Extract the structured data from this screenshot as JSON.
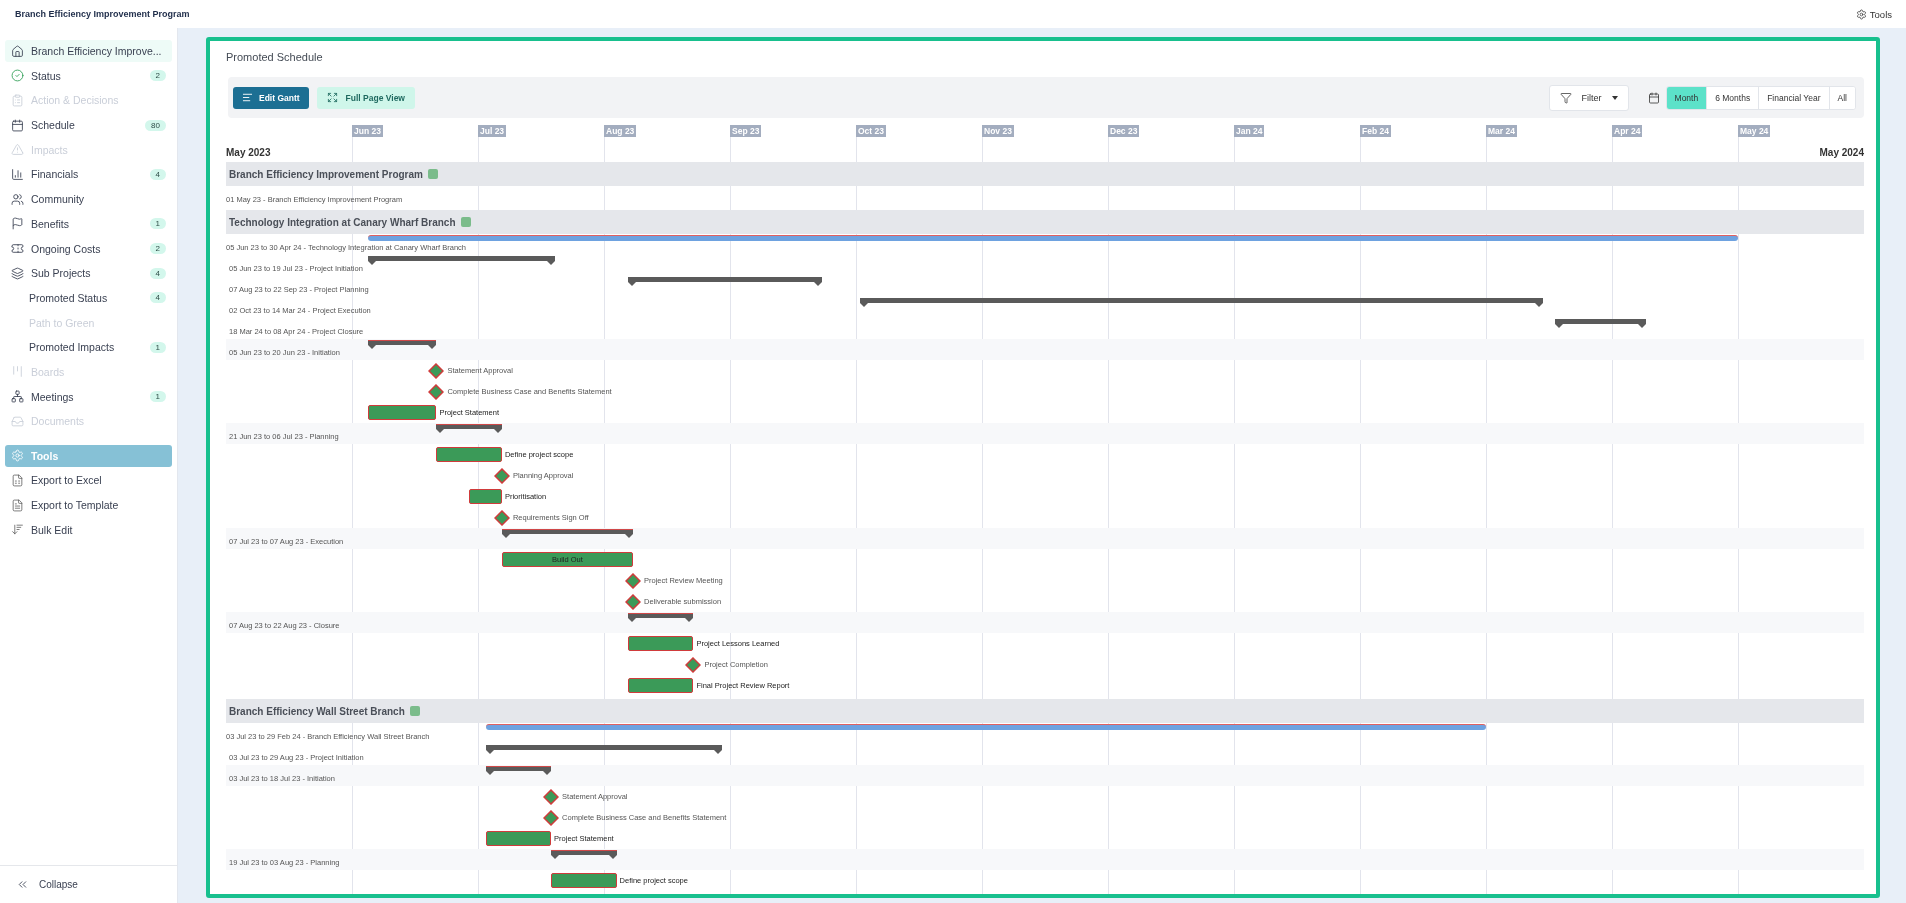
{
  "app_bar": {
    "title": "Branch Efficiency Improvement Program",
    "tools_label": "Tools"
  },
  "sidebar": {
    "items": [
      {
        "label": "Branch Efficiency Improve...",
        "selected": true,
        "disabled": false
      },
      {
        "label": "Status",
        "badge": "2",
        "selected": false,
        "disabled": false
      },
      {
        "label": "Action & Decisions",
        "selected": false,
        "disabled": true
      },
      {
        "label": "Schedule",
        "badge": "80",
        "selected": false,
        "disabled": false
      },
      {
        "label": "Impacts",
        "selected": false,
        "disabled": true
      },
      {
        "label": "Financials",
        "badge": "4",
        "selected": false,
        "disabled": false
      },
      {
        "label": "Community",
        "selected": false,
        "disabled": false
      },
      {
        "label": "Benefits",
        "badge": "1",
        "selected": false,
        "disabled": false
      },
      {
        "label": "Ongoing Costs",
        "badge": "2",
        "selected": false,
        "disabled": false
      },
      {
        "label": "Sub Projects",
        "badge": "4",
        "selected": false,
        "disabled": false,
        "children": [
          {
            "label": "Promoted Status",
            "badge": "4",
            "selected": false,
            "disabled": false
          },
          {
            "label": "Path to Green",
            "selected": false,
            "disabled": true
          },
          {
            "label": "Promoted Impacts",
            "badge": "1",
            "selected": false,
            "disabled": false
          }
        ]
      },
      {
        "label": "Boards",
        "selected": false,
        "disabled": true
      },
      {
        "label": "Meetings",
        "badge": "1",
        "selected": false,
        "disabled": false
      },
      {
        "label": "Documents",
        "selected": false,
        "disabled": true
      }
    ],
    "tools": {
      "label": "Tools",
      "expanded": true,
      "items": [
        "Export to Excel",
        "Export to Template",
        "Bulk Edit"
      ]
    },
    "collapse_label": "Collapse"
  },
  "panel": {
    "title": "Promoted Schedule"
  },
  "toolbar": {
    "edit_button": "Edit Gantt",
    "full_page_button": "Full Page View",
    "filter_button": "Filter",
    "ranges": [
      {
        "label": "Month",
        "selected": true
      },
      {
        "label": "6 Months",
        "selected": false
      },
      {
        "label": "Financial Year",
        "selected": false
      },
      {
        "label": "All",
        "selected": false
      }
    ]
  },
  "gantt": {
    "start_label": "May 2023",
    "end_label": "May 2024",
    "months": [
      "Jun 23",
      "Jul 23",
      "Aug 23",
      "Sep 23",
      "Oct 23",
      "Nov 23",
      "Dec 23",
      "Jan 24",
      "Feb 24",
      "Mar 24",
      "Apr 24",
      "May 24"
    ],
    "sections": [
      {
        "title": "Branch Efficiency Improvement Program",
        "rows": [
          {
            "kind": "caption",
            "label": "01 May 23 - Branch Efficiency Improvement Program"
          }
        ]
      },
      {
        "title": "Technology Integration at Canary Wharf Branch",
        "rows": [
          {
            "kind": "summary",
            "label": "05 Jun 23 to 30 Apr 24 - Technology Integration at Canary Wharf Branch"
          },
          {
            "kind": "phase",
            "label": "05 Jun 23 to 19 Jul 23 - Project Initiation"
          },
          {
            "kind": "phase",
            "label": "07 Aug 23 to 22 Sep 23 - Project Planning"
          },
          {
            "kind": "phase",
            "label": "02 Oct 23 to 14 Mar 24 - Project Execution"
          },
          {
            "kind": "phase",
            "label": "18 Mar 24 to 08 Apr 24 - Project Closure"
          },
          {
            "kind": "stage",
            "label": "05 Jun 23 to 20 Jun 23 - Initiation"
          },
          {
            "kind": "milestone",
            "label": "Statement Approval"
          },
          {
            "kind": "milestone",
            "label": "Complete Business Case and Benefits Statement"
          },
          {
            "kind": "task",
            "label": "Project Statement"
          },
          {
            "kind": "stage",
            "label": "21 Jun 23 to 06 Jul 23 - Planning"
          },
          {
            "kind": "task",
            "label": "Define project scope"
          },
          {
            "kind": "milestone",
            "label": "Planning Approval"
          },
          {
            "kind": "task",
            "label": "Prioritisation"
          },
          {
            "kind": "milestone",
            "label": "Requirements Sign Off"
          },
          {
            "kind": "stage",
            "label": "07 Jul 23 to 07 Aug 23 - Execution"
          },
          {
            "kind": "task",
            "label": "Build Out"
          },
          {
            "kind": "milestone",
            "label": "Project Review Meeting"
          },
          {
            "kind": "milestone",
            "label": "Deliverable submission"
          },
          {
            "kind": "stage",
            "label": "07 Aug 23 to 22 Aug 23 - Closure"
          },
          {
            "kind": "task",
            "label": "Project Lessons Learned"
          },
          {
            "kind": "milestone",
            "label": "Project Completion"
          },
          {
            "kind": "task",
            "label": "Final Project Review Report"
          }
        ]
      },
      {
        "title": "Branch Efficiency Wall Street Branch",
        "rows": [
          {
            "kind": "summary",
            "label": "03 Jul 23 to 29 Feb 24 - Branch Efficiency Wall Street Branch"
          },
          {
            "kind": "phase",
            "label": "03 Jul 23 to 29 Aug 23 - Project Initiation"
          },
          {
            "kind": "stage",
            "label": "03 Jul 23 to 18 Jul 23 - Initiation"
          },
          {
            "kind": "milestone",
            "label": "Statement Approval"
          },
          {
            "kind": "milestone",
            "label": "Complete Business Case and Benefits Statement"
          },
          {
            "kind": "task",
            "label": "Project Statement"
          },
          {
            "kind": "stage",
            "label": "19 Jul 23 to 03 Aug 23 - Planning"
          },
          {
            "kind": "task",
            "label": "Define project scope"
          }
        ]
      }
    ]
  }
}
